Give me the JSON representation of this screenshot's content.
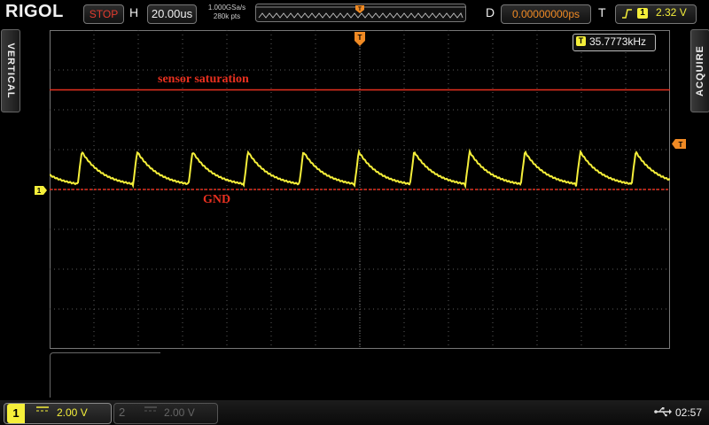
{
  "brand": "RIGOL",
  "run_state": "STOP",
  "horizontal": {
    "label": "H",
    "scale": "20.00us"
  },
  "acquisition": {
    "sample_rate": "1.000GSa/s",
    "memory_depth": "280k pts"
  },
  "delay": {
    "label": "D",
    "value": "0.00000000ps"
  },
  "trigger": {
    "label": "T",
    "source_icon": "1",
    "level": "2.32 V",
    "edge": "rising-edge-icon"
  },
  "side_tabs": {
    "vertical": "VERTICAL",
    "acquire": "ACQUIRE"
  },
  "measurement": {
    "icon": "T",
    "frequency": "35.7773kHz"
  },
  "annotations": {
    "saturation": "sensor saturation",
    "ground": "GND"
  },
  "markers": {
    "channel1": "1",
    "trigger": "T"
  },
  "channels": [
    {
      "number": "1",
      "coupling": "DC",
      "scale": "2.00 V",
      "active": true
    },
    {
      "number": "2",
      "coupling": "DC",
      "scale": "2.00 V",
      "active": false
    }
  ],
  "clock": "02:57",
  "colors": {
    "ch1": "#f5ef3a",
    "annotation": "#e8301f",
    "trigger": "#f08a24",
    "grid": "#5a5a5a"
  },
  "waveform": {
    "period_us": 25.0,
    "high_div": 0.95,
    "low_div": 0.05,
    "saturation_div": 2.5,
    "offset_div": 0
  }
}
